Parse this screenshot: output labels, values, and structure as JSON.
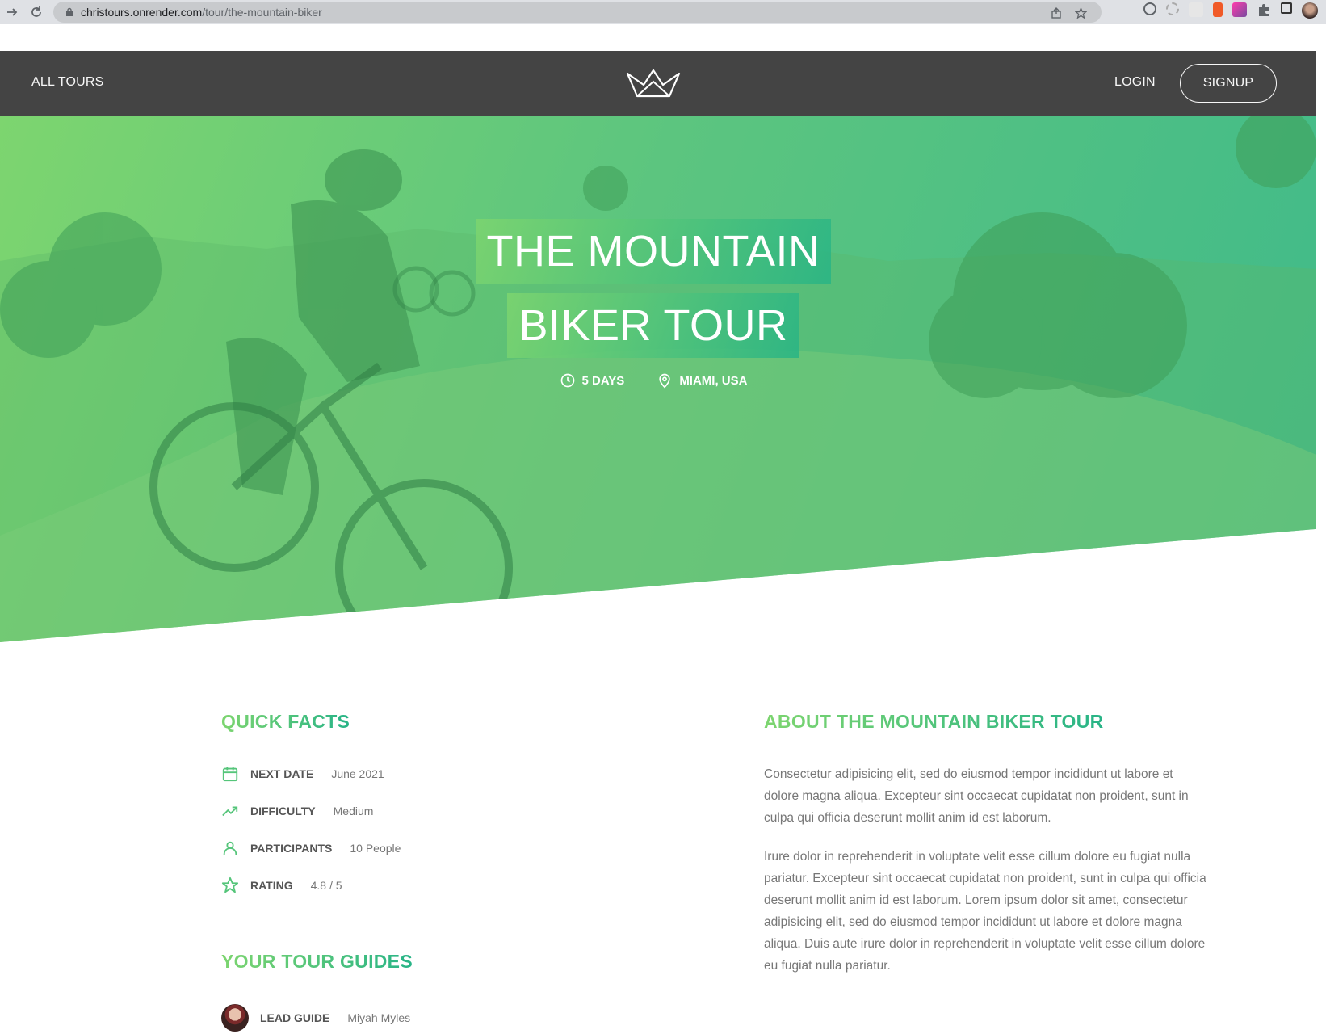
{
  "browser": {
    "url_domain": "christours.onrender.com",
    "url_path": "/tour/the-mountain-biker"
  },
  "header": {
    "all_tours": "ALL TOURS",
    "login": "LOGIN",
    "signup": "SIGNUP"
  },
  "hero": {
    "title_line1": "THE MOUNTAIN",
    "title_line2": "BIKER TOUR",
    "duration": "5 DAYS",
    "location": "MIAMI, USA"
  },
  "quick_facts": {
    "heading": "QUICK FACTS",
    "items": [
      {
        "label": "NEXT DATE",
        "value": "June 2021",
        "icon": "calendar-icon"
      },
      {
        "label": "DIFFICULTY",
        "value": "Medium",
        "icon": "trending-up-icon"
      },
      {
        "label": "PARTICIPANTS",
        "value": "10 People",
        "icon": "user-icon"
      },
      {
        "label": "RATING",
        "value": "4.8 / 5",
        "icon": "star-icon"
      }
    ]
  },
  "tour_guides": {
    "heading": "YOUR TOUR GUIDES",
    "items": [
      {
        "role": "LEAD GUIDE",
        "name": "Miyah Myles"
      }
    ]
  },
  "about": {
    "heading": "ABOUT THE MOUNTAIN BIKER TOUR",
    "paragraphs": [
      "Consectetur adipisicing elit, sed do eiusmod tempor incididunt ut labore et dolore magna aliqua. Excepteur sint occaecat cupidatat non proident, sunt in culpa qui officia deserunt mollit anim id est laborum.",
      "Irure dolor in reprehenderit in voluptate velit esse cillum dolore eu fugiat nulla pariatur. Excepteur sint occaecat cupidatat non proident, sunt in culpa qui officia deserunt mollit anim id est laborum. Lorem ipsum dolor sit amet, consectetur adipisicing elit, sed do eiusmod tempor incididunt ut labore et dolore magna aliqua. Duis aute irure dolor in reprehenderit in voluptate velit esse cillum dolore eu fugiat nulla pariatur."
    ]
  },
  "colors": {
    "brand_green": "#55c57a",
    "gradient_light": "#7dd56f",
    "gradient_dark": "#28b487",
    "header_bg": "#444444"
  }
}
